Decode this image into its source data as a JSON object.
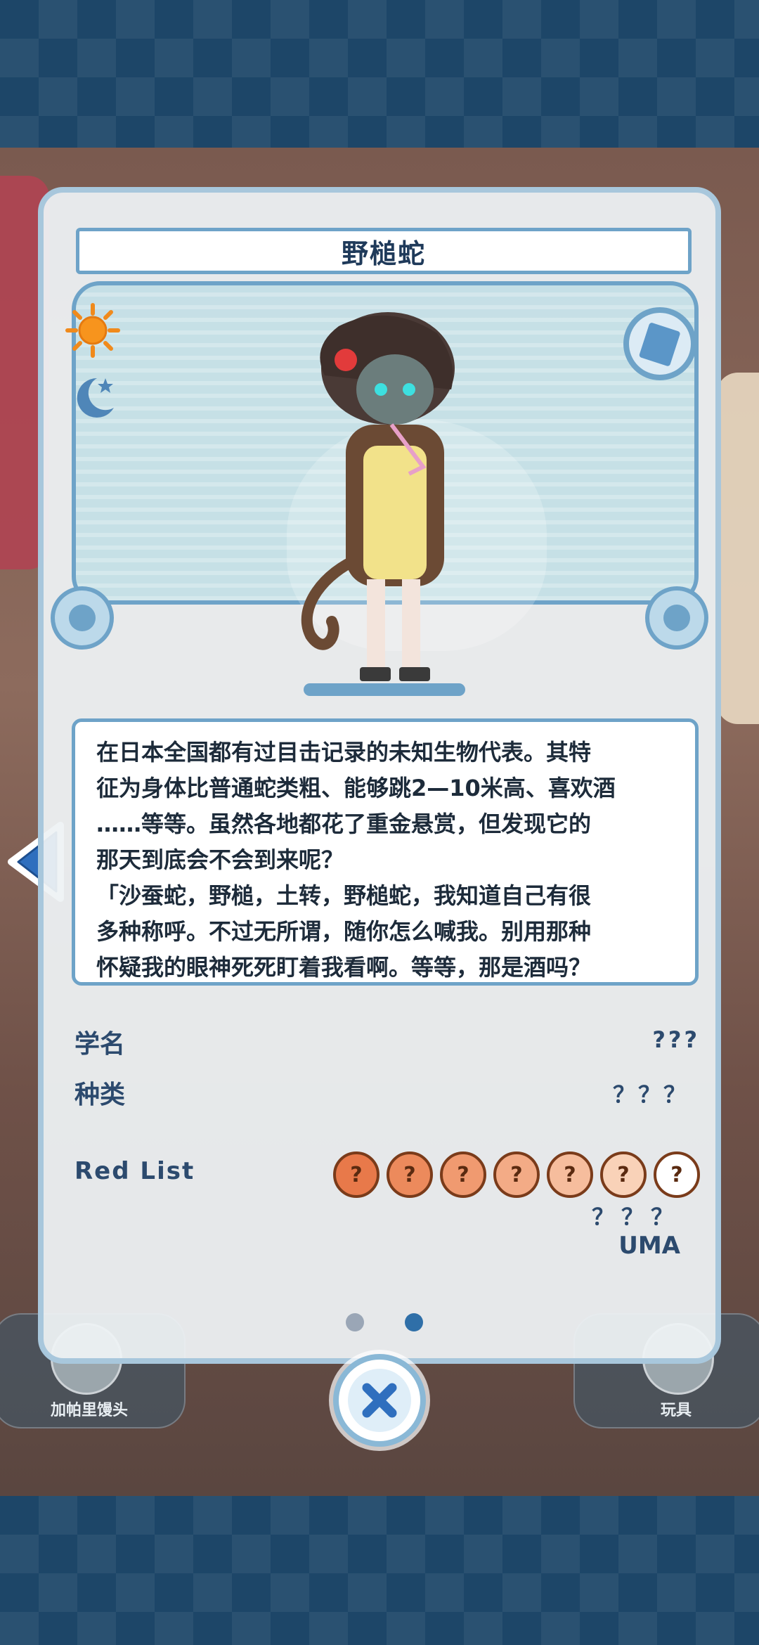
{
  "title": "野槌蛇",
  "description": "在日本全国都有过目击记录的未知生物代表。其特\n征为身体比普通蛇类粗、能够跳2—10米高、喜欢酒\n……等等。虽然各地都花了重金悬赏，但发现它的\n那天到底会不会到来呢？\n「沙蚕蛇，野槌，土转，野槌蛇，我知道自己有很\n多种称呼。不过无所谓，随你怎么喊我。别用那种\n怀疑我的眼神死死盯着我看啊。等等，那是酒吗？",
  "fields": {
    "scientific_name_label": "学名",
    "scientific_name_value": "???",
    "species_label": "种类",
    "species_value": "？？？",
    "redlist_label": "Red List",
    "redlist_status": "？？？",
    "category": "UMA"
  },
  "redlist_levels": [
    {
      "text": "?",
      "color": "#e8794a"
    },
    {
      "text": "?",
      "color": "#ec8a5c"
    },
    {
      "text": "?",
      "color": "#f09a70"
    },
    {
      "text": "?",
      "color": "#f3ab86"
    },
    {
      "text": "?",
      "color": "#f6bd9d"
    },
    {
      "text": "?",
      "color": "#f9d2b8"
    },
    {
      "text": "?",
      "color": "#ffffff"
    }
  ],
  "bottom_nav": {
    "left_label": "加帕里馒头",
    "right_label": "玩具"
  },
  "pagination": {
    "total": 2,
    "current": 2
  },
  "colors": {
    "frame_blue": "#6ea3c8",
    "title_text": "#1f3a5a",
    "dot_active": "#2f6fa8",
    "dot_inactive": "#9aa6b6"
  },
  "icons": {
    "day": "sun-icon",
    "night": "moon-icon",
    "card": "card-icon",
    "close": "close-icon",
    "prev": "left-arrow-icon"
  }
}
